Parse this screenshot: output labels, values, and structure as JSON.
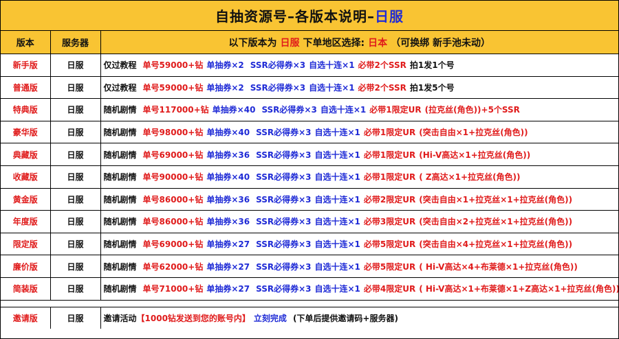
{
  "title": {
    "part1": "自抽资源号–各版本说明–",
    "part2": "日服"
  },
  "header": {
    "col_version": "版本",
    "col_server": "服务器",
    "desc_intro": "以下版本为",
    "desc_server": "日服",
    "desc_region_label": "下单地区选择:",
    "desc_region": "日本",
    "desc_note": "（可换绑 新手池未动）"
  },
  "colors": {
    "header_bg": "#f9c433",
    "red": "#e01b1b",
    "blue": "#1f2bd6",
    "black": "#111111"
  },
  "rows": [
    {
      "version": "新手版",
      "server": "日服",
      "story": "仅过教程",
      "diamonds": "单号59000+钻",
      "draw": "单抽券×2",
      "ssr": "SSR必得券×3",
      "ten": "自选十连×1",
      "guarantee": "必带2个SSR",
      "extra": "拍1发1个号"
    },
    {
      "version": "普通版",
      "server": "日服",
      "story": "仅过教程",
      "diamonds": "单号59000+钻",
      "draw": "单抽券×2",
      "ssr": "SSR必得券×3",
      "ten": "自选十连×1",
      "guarantee": "必带2个SSR",
      "extra": "拍1发5个号"
    },
    {
      "version": "特典版",
      "server": "日服",
      "story": "随机剧情",
      "diamonds": "单号117000+钻",
      "draw": "单抽券×40",
      "ssr": "SSR必得券×3",
      "ten": "自选十连×1",
      "guarantee": "必带1限定UR",
      "extra": "(拉克丝(角色))+5个SSR"
    },
    {
      "version": "豪华版",
      "server": "日服",
      "story": "随机剧情",
      "diamonds": "单号98000+钻",
      "draw": "单抽券×40",
      "ssr": "SSR必得券×3",
      "ten": "自选十连×1",
      "guarantee": "必带1限定UR",
      "extra": "(突击自由×1+拉克丝(角色))"
    },
    {
      "version": "典藏版",
      "server": "日服",
      "story": "随机剧情",
      "diamonds": "单号69000+钻",
      "draw": "单抽券×36",
      "ssr": "SSR必得券×3",
      "ten": "自选十连×1",
      "guarantee": "必带1限定UR",
      "extra": "(Hi-V高达×1+拉克丝(角色))"
    },
    {
      "version": "收藏版",
      "server": "日服",
      "story": "随机剧情",
      "diamonds": "单号90000+钻",
      "draw": "单抽券×40",
      "ssr": "SSR必得券×3",
      "ten": "自选十连×1",
      "guarantee": "必带1限定UR",
      "extra": "( Z高达×1+拉克丝(角色))"
    },
    {
      "version": "黄金版",
      "server": "日服",
      "story": "随机剧情",
      "diamonds": "单号86000+钻",
      "draw": "单抽券×36",
      "ssr": "SSR必得券×3",
      "ten": "自选十连×1",
      "guarantee": "必带2限定UR",
      "extra": "(突击自由×1+拉克丝×1+拉克丝(角色))"
    },
    {
      "version": "年度版",
      "server": "日服",
      "story": "随机剧情",
      "diamonds": "单号86000+钻",
      "draw": "单抽券×36",
      "ssr": "SSR必得券×3",
      "ten": "自选十连×1",
      "guarantee": "必带3限定UR",
      "extra": "(突击自由×2+拉克丝×1+拉克丝(角色))"
    },
    {
      "version": "限定版",
      "server": "日服",
      "story": "随机剧情",
      "diamonds": "单号69000+钻",
      "draw": "单抽券×27",
      "ssr": "SSR必得券×3",
      "ten": "自选十连×1",
      "guarantee": "必带5限定UR",
      "extra": "(突击自由×4+拉克丝×1+拉克丝(角色))"
    },
    {
      "version": "廉价版",
      "server": "日服",
      "story": "随机剧情",
      "diamonds": "单号62000+钻",
      "draw": "单抽券×27",
      "ssr": "SSR必得券×3",
      "ten": "自选十连×1",
      "guarantee": "必带5限定UR",
      "extra": "( Hi-V高达×4+布莱德×1+拉克丝(角色))"
    },
    {
      "version": "简装版",
      "server": "日服",
      "story": "随机剧情",
      "diamonds": "单号71000+钻",
      "draw": "单抽券×27",
      "ssr": "SSR必得券×3",
      "ten": "自选十连×1",
      "guarantee": "必带4限定UR",
      "extra": "( Hi-V高达×1+布莱德×1+Z高达×1+拉克丝(角色))"
    }
  ],
  "invite": {
    "version": "邀请版",
    "server": "日服",
    "label": "邀请活动",
    "bracket": "【1000钻发送到您的账号内】",
    "done": "立刻完成",
    "note": "(下单后提供邀请码+服务器)"
  }
}
